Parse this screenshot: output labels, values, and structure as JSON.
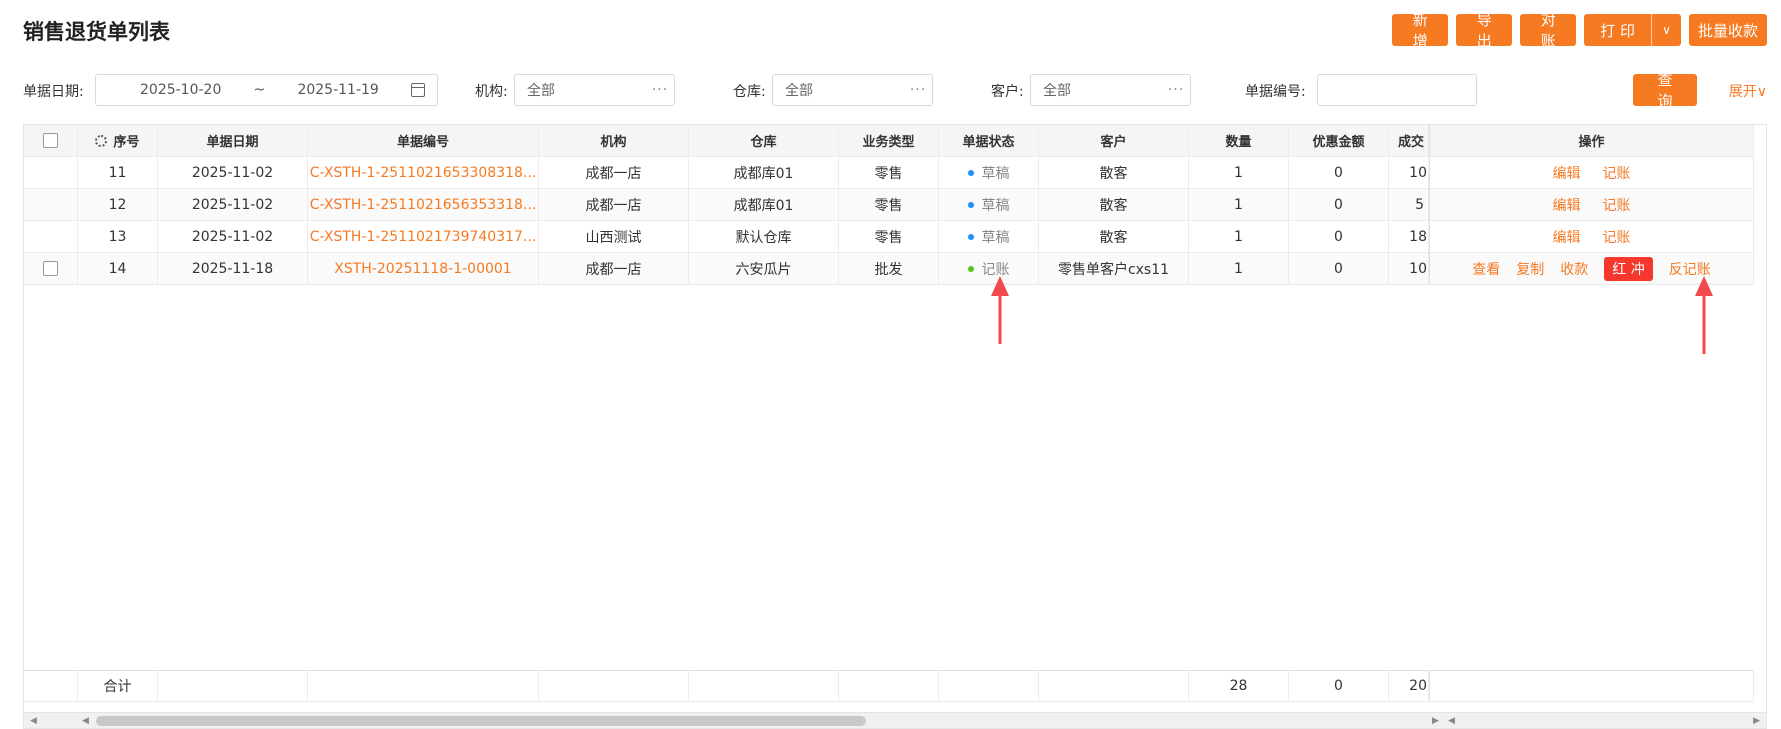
{
  "page": {
    "title": "销售退货单列表"
  },
  "toolbar": {
    "new_label": "新 增",
    "export_label": "导 出",
    "reconcile_label": "对 账",
    "print_label": "打 印",
    "print_dropdown_icon": "chevron-down-icon",
    "batch_collect_label": "批量收款"
  },
  "filters": {
    "date_label": "单据日期:",
    "date_start": "2025-10-20",
    "date_sep": "~",
    "date_end": "2025-11-19",
    "org_label": "机构:",
    "org_value": "全部",
    "warehouse_label": "仓库:",
    "warehouse_value": "全部",
    "customer_label": "客户:",
    "customer_value": "全部",
    "docno_label": "单据编号:",
    "docno_value": "",
    "query_label": "查 询",
    "expand_label": "展开∨"
  },
  "table": {
    "columns": [
      "序号",
      "单据日期",
      "单据编号",
      "机构",
      "仓库",
      "业务类型",
      "单据状态",
      "客户",
      "数量",
      "优惠金额",
      "成交",
      "操作"
    ],
    "rows": [
      {
        "seq": "11",
        "date": "2025-11-02",
        "docno": "C-XSTH-1-2511021653308318...",
        "org": "成都一店",
        "warehouse": "成都库01",
        "type": "零售",
        "status": "草稿",
        "customer": "散客",
        "qty": "1",
        "discount": "0",
        "deal": "10",
        "ops": [
          "编辑",
          "记账"
        ]
      },
      {
        "seq": "12",
        "date": "2025-11-02",
        "docno": "C-XSTH-1-2511021656353318...",
        "org": "成都一店",
        "warehouse": "成都库01",
        "type": "零售",
        "status": "草稿",
        "customer": "散客",
        "qty": "1",
        "discount": "0",
        "deal": "5",
        "ops": [
          "编辑",
          "记账"
        ]
      },
      {
        "seq": "13",
        "date": "2025-11-02",
        "docno": "C-XSTH-1-2511021739740317...",
        "org": "山西测试",
        "warehouse": "默认仓库",
        "type": "零售",
        "status": "草稿",
        "customer": "散客",
        "qty": "1",
        "discount": "0",
        "deal": "18",
        "ops": [
          "编辑",
          "记账"
        ]
      },
      {
        "seq": "14",
        "date": "2025-11-18",
        "docno": "XSTH-20251118-1-00001",
        "org": "成都一店",
        "warehouse": "六安瓜片",
        "type": "批发",
        "status": "记账",
        "customer": "零售单客户cxs11",
        "qty": "1",
        "discount": "0",
        "deal": "10",
        "ops": [
          "查看",
          "复制",
          "收款",
          "红 冲",
          "反记账"
        ]
      }
    ],
    "footer": {
      "label": "合计",
      "qty": "28",
      "discount": "0",
      "deal": "20"
    }
  },
  "colors": {
    "accent": "#f57a21",
    "danger": "#f5372e",
    "draft_dot": "#1890ff",
    "posted_dot": "#52c41a"
  }
}
